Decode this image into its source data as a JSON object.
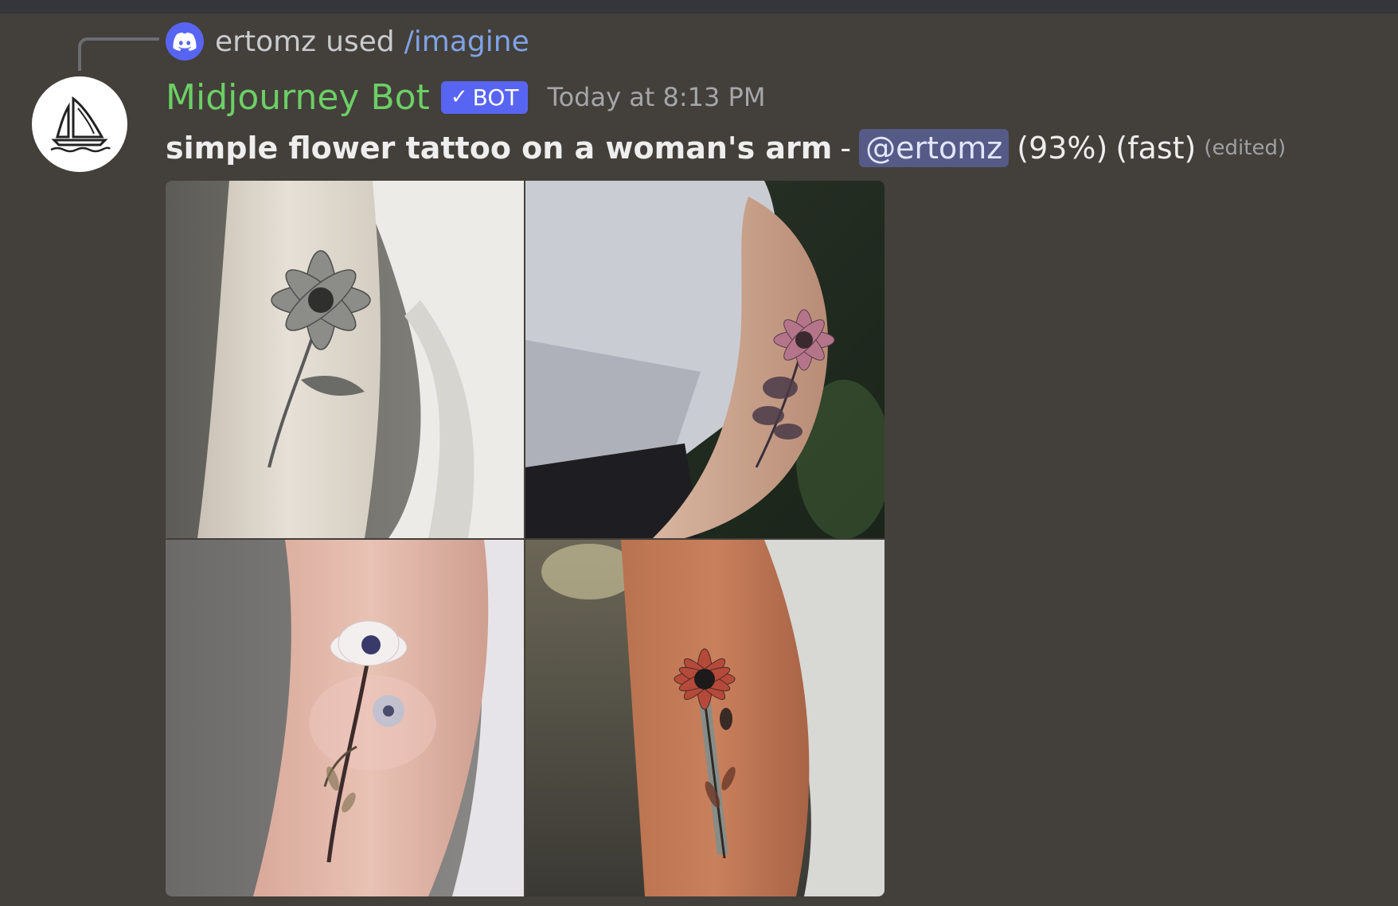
{
  "reply": {
    "user": "ertomz",
    "used_text": "used",
    "command": "/imagine",
    "icon": "discord-icon"
  },
  "message": {
    "author": "Midjourney Bot",
    "bot_tag": "BOT",
    "timestamp": "Today at 8:13 PM",
    "avatar_icon": "sailboat-icon",
    "prompt": "simple flower tattoo on a woman's arm",
    "dash": "-",
    "mention": "@ertomz",
    "progress": "(93%)",
    "progress_value": 93,
    "mode": "(fast)",
    "edited": "(edited)"
  },
  "images": [
    {
      "name": "grid-image-1",
      "flower": "gray-dahlia"
    },
    {
      "name": "grid-image-2",
      "flower": "pink-daisy"
    },
    {
      "name": "grid-image-3",
      "flower": "white-anemone"
    },
    {
      "name": "grid-image-4",
      "flower": "red-daisy"
    }
  ],
  "colors": {
    "background": "#433f3a",
    "bot_name": "#6ccf66",
    "bot_tag": "#5865f2",
    "mention_bg": "#555a86",
    "command": "#7fa3e6"
  }
}
